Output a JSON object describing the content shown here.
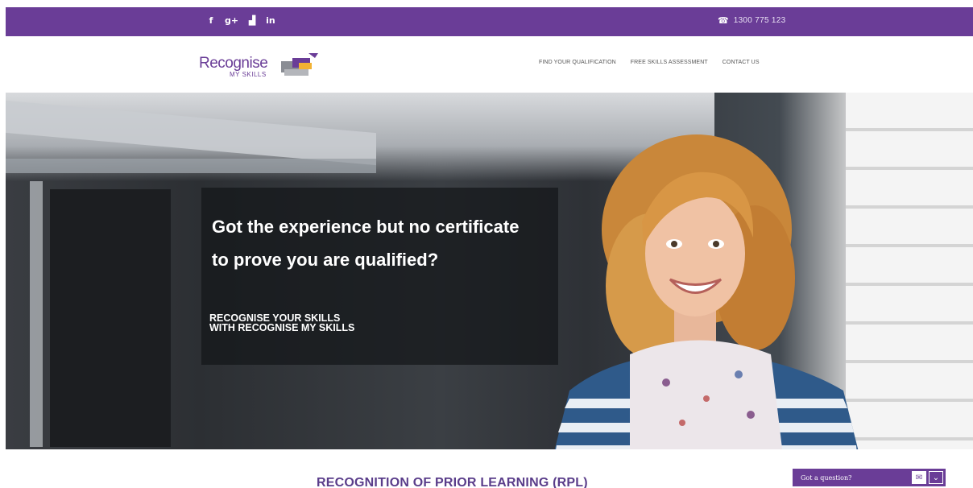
{
  "topbar": {
    "social": [
      {
        "name": "facebook-icon",
        "glyph": "f"
      },
      {
        "name": "google-plus-icon",
        "glyph": "g+"
      },
      {
        "name": "youtube-icon",
        "glyph": "▟"
      },
      {
        "name": "linkedin-icon",
        "glyph": "in"
      }
    ],
    "phone_icon": "phone-icon",
    "phone": "1300 775 123"
  },
  "header": {
    "logo_text": "Recognise",
    "logo_sub": "MY SKILLS",
    "nav": [
      {
        "label": "FIND YOUR QUALIFICATION"
      },
      {
        "label": "FREE SKILLS ASSESSMENT"
      },
      {
        "label": "CONTACT US"
      }
    ]
  },
  "hero": {
    "headline_line1": "Got the experience but no certificate",
    "headline_line2": "to prove you are qualified?",
    "sub_line1": "RECOGNISE YOUR SKILLS",
    "sub_line2": "WITH RECOGNISE MY SKILLS"
  },
  "section": {
    "title": "RECOGNITION OF PRIOR LEARNING (RPL)"
  },
  "chat": {
    "label": "Got a question?",
    "mail_icon": "mail-icon",
    "toggle_icon": "chevron-down-icon"
  },
  "colors": {
    "brand_purple": "#6a3d97",
    "heading_purple": "#5a3d8a"
  }
}
